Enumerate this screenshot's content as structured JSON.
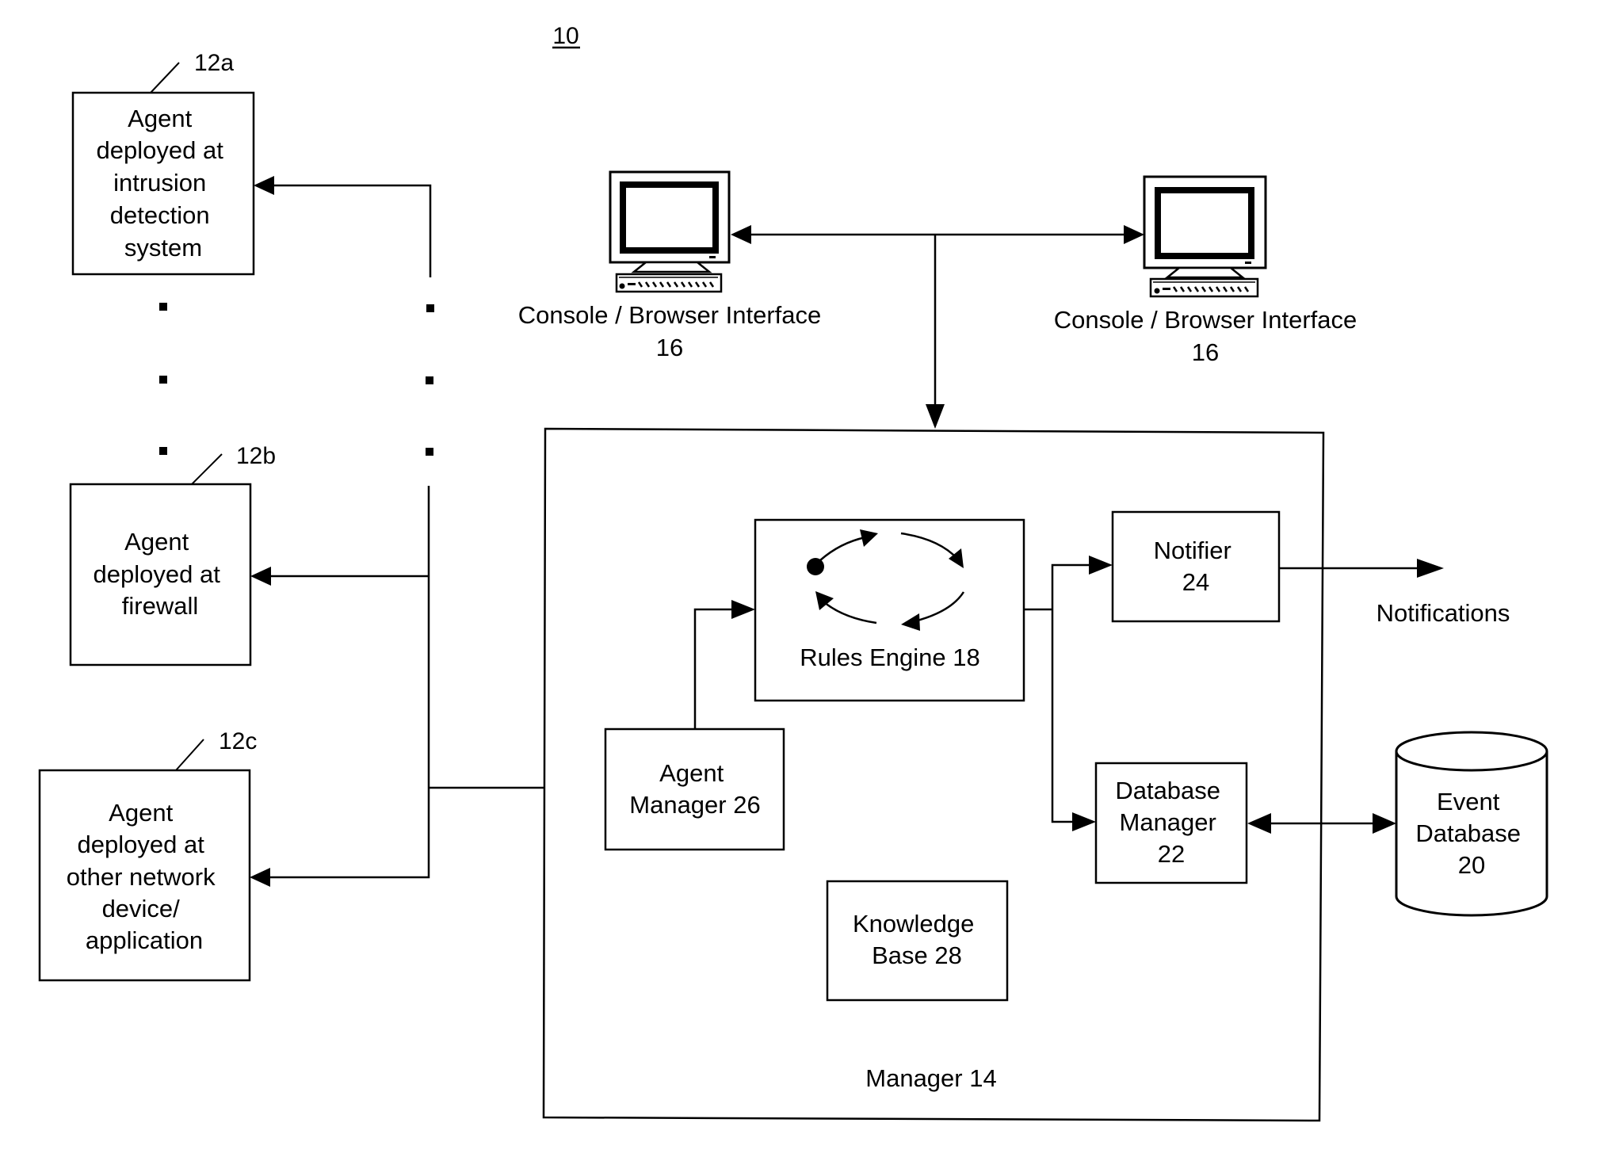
{
  "figure": {
    "reference_number": "10",
    "type": "system block diagram"
  },
  "agents": [
    {
      "id": "12a",
      "ref": "12a",
      "lines": [
        "Agent",
        "deployed at",
        "intrusion",
        "detection",
        "system"
      ]
    },
    {
      "id": "12b",
      "ref": "12b",
      "lines": [
        "Agent",
        "deployed at",
        "firewall"
      ]
    },
    {
      "id": "12c",
      "ref": "12c",
      "lines": [
        "Agent",
        "deployed at",
        "other network",
        "device/",
        "application"
      ]
    }
  ],
  "consoles": [
    {
      "label": "Console / Browser Interface",
      "number": "16",
      "icon": "computer-monitor-icon"
    },
    {
      "label": "Console / Browser Interface",
      "number": "16",
      "icon": "computer-monitor-icon"
    }
  ],
  "manager": {
    "label": "Manager 14",
    "components": {
      "rules_engine": {
        "label": "Rules Engine 18",
        "icon": "cycle-arrows-icon"
      },
      "notifier": {
        "lines": [
          "Notifier",
          "24"
        ]
      },
      "agent_manager": {
        "lines": [
          "Agent",
          "Manager 26"
        ]
      },
      "database_manager": {
        "lines": [
          "Database",
          "Manager",
          "22"
        ]
      },
      "knowledge_base": {
        "lines": [
          "Knowledge",
          "Base 28"
        ]
      }
    }
  },
  "external": {
    "notifications": "Notifications",
    "event_database": {
      "lines": [
        "Event",
        "Database",
        "20"
      ],
      "icon": "database-cylinder-icon"
    }
  },
  "connections": [
    {
      "from": "agent-bus",
      "to": "12a",
      "arrow": "to"
    },
    {
      "from": "agent-bus",
      "to": "12b",
      "arrow": "to"
    },
    {
      "from": "agent-bus",
      "to": "12c",
      "arrow": "to"
    },
    {
      "from": "agent-bus",
      "to": "agent_manager",
      "arrow": "to"
    },
    {
      "from": "agent_manager",
      "to": "rules_engine",
      "arrow": "to"
    },
    {
      "from": "rules_engine",
      "to": "notifier",
      "arrow": "to"
    },
    {
      "from": "rules_engine",
      "to": "database_manager",
      "arrow": "to"
    },
    {
      "from": "notifier",
      "to": "notifications",
      "arrow": "to"
    },
    {
      "from": "database_manager",
      "to": "event_database",
      "arrow": "both"
    },
    {
      "from": "consoles",
      "to": "consoles",
      "arrow": "both"
    },
    {
      "from": "consoles",
      "to": "manager",
      "arrow": "to"
    }
  ]
}
